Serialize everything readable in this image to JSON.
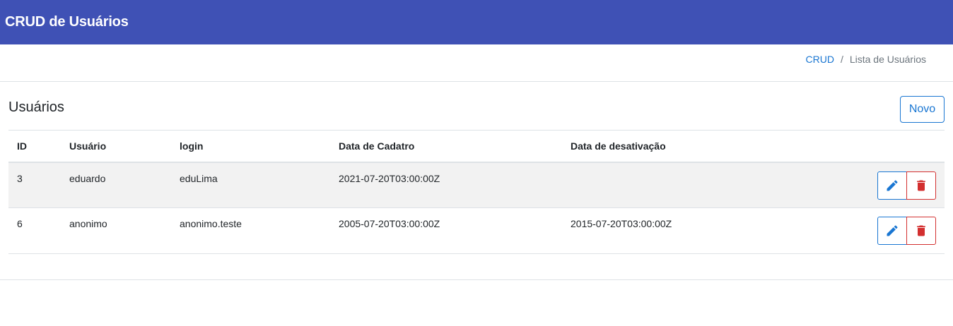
{
  "app": {
    "title": "CRUD de Usuários"
  },
  "breadcrumb": {
    "root": "CRUD",
    "separator": "/",
    "current": "Lista de Usuários"
  },
  "card": {
    "title": "Usuários",
    "new_button": "Novo"
  },
  "table": {
    "headers": {
      "id": "ID",
      "usuario": "Usuário",
      "login": "login",
      "cadastro": "Data de Cadatro",
      "desativacao": "Data de desativação"
    },
    "rows": [
      {
        "id": "3",
        "usuario": "eduardo",
        "login": "eduLima",
        "cadastro": "2021-07-20T03:00:00Z",
        "desativacao": ""
      },
      {
        "id": "6",
        "usuario": "anonimo",
        "login": "anonimo.teste",
        "cadastro": "2005-07-20T03:00:00Z",
        "desativacao": "2015-07-20T03:00:00Z"
      }
    ],
    "row_actions": {
      "edit_icon": "pencil-icon",
      "delete_icon": "trash-icon"
    }
  },
  "colors": {
    "header": "#3f51b5",
    "primary": "#1976d2",
    "danger": "#d32f2f",
    "stripe": "#f2f2f2"
  }
}
